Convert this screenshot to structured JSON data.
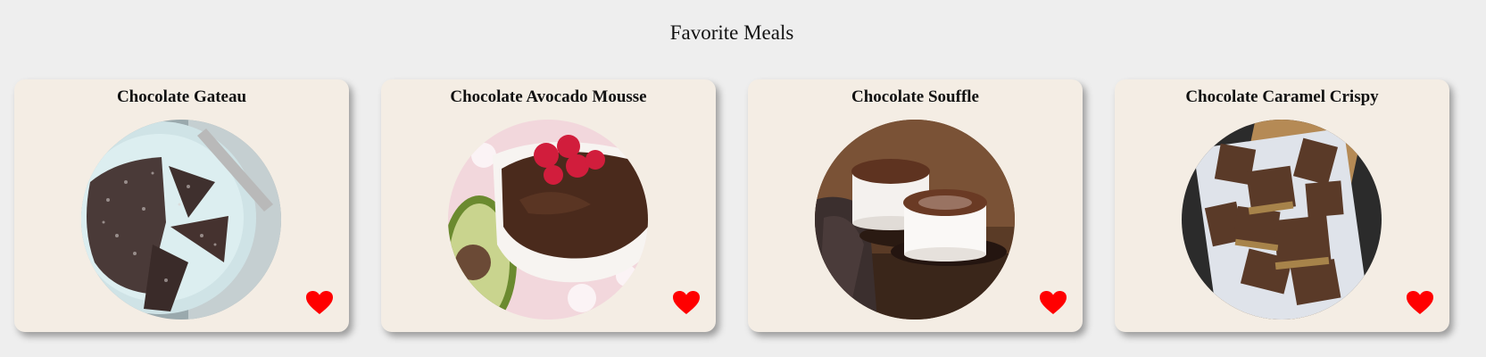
{
  "page": {
    "title": "Favorite Meals"
  },
  "meals": [
    {
      "name": "Chocolate Gateau",
      "image": "chocolate-gateau-photo",
      "favorite": true,
      "heart_icon": "heart-icon"
    },
    {
      "name": "Chocolate Avocado Mousse",
      "image": "chocolate-avocado-mousse-photo",
      "favorite": true,
      "heart_icon": "heart-icon"
    },
    {
      "name": "Chocolate Souffle",
      "image": "chocolate-souffle-photo",
      "favorite": true,
      "heart_icon": "heart-icon"
    },
    {
      "name": "Chocolate Caramel Crispy",
      "image": "chocolate-caramel-crispy-photo",
      "favorite": true,
      "heart_icon": "heart-icon"
    }
  ],
  "colors": {
    "background": "#eeeeee",
    "card": "#f4ede4",
    "heart": "#ff0000"
  }
}
